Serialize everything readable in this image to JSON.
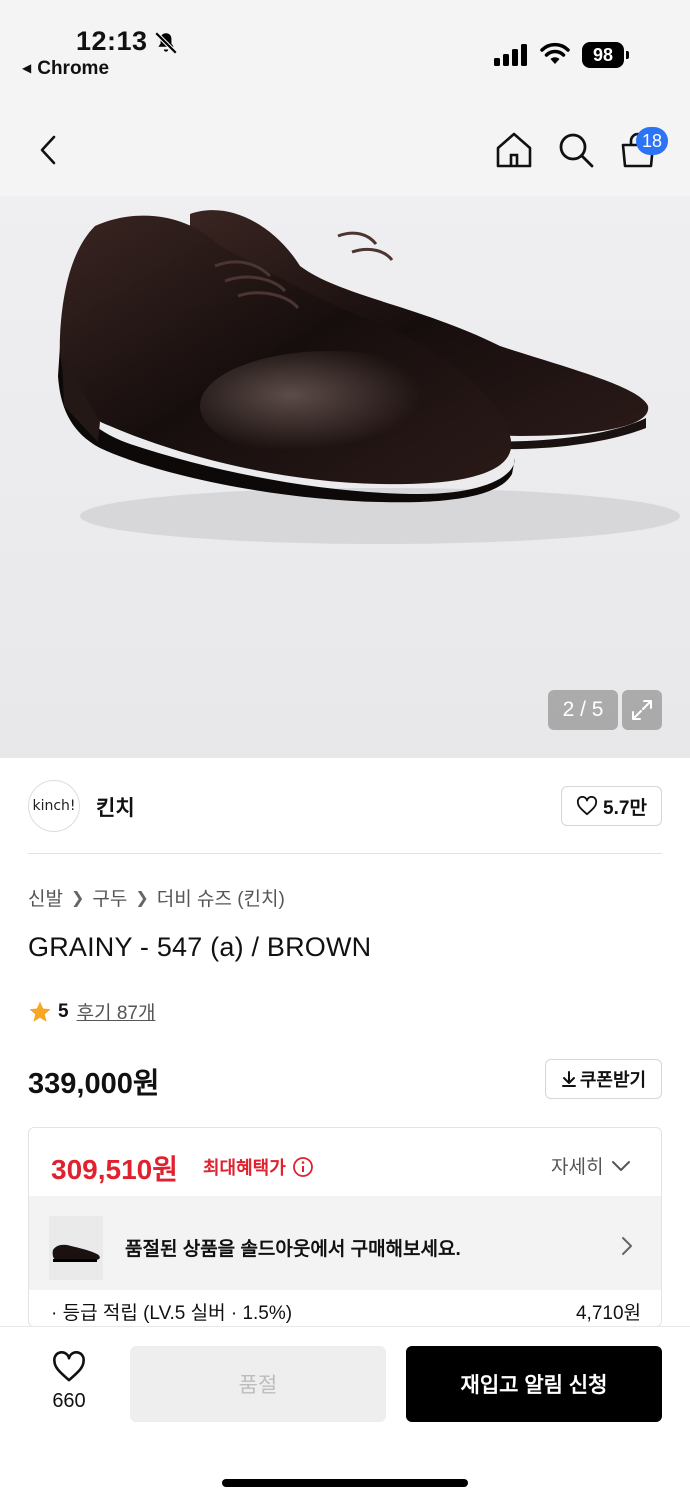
{
  "status_bar": {
    "time": "12:13",
    "back_app": "Chrome",
    "battery": "98"
  },
  "nav": {
    "cart_count": "18"
  },
  "hero": {
    "page_indicator": "2 / 5"
  },
  "brand": {
    "logo_text": "kinch!",
    "name": "킨치",
    "like_count": "5.7만"
  },
  "breadcrumb": [
    "신발",
    "구두",
    "더비 슈즈 (킨치)"
  ],
  "product": {
    "title": "GRAINY - 547 (a) / BROWN",
    "rating": "5",
    "reviews": "후기 87개",
    "price": "339,000원",
    "coupon_label": "쿠폰받기"
  },
  "benefit": {
    "max_price": "309,510원",
    "max_label": "최대혜택가",
    "detail_label": "자세히",
    "soldout_banner": "품절된 상품을 솔드아웃에서 구매해보세요.",
    "points_label": "· 등급 적립 (LV.5 실버 · 1.5%)",
    "points_value": "4,710원"
  },
  "bottom_bar": {
    "wish_count": "660",
    "soldout_label": "품절",
    "restock_label": "재입고 알림 신청"
  },
  "colors": {
    "accent_red": "#e0222e",
    "badge_blue": "#2a74f5",
    "star": "#f5a623"
  }
}
